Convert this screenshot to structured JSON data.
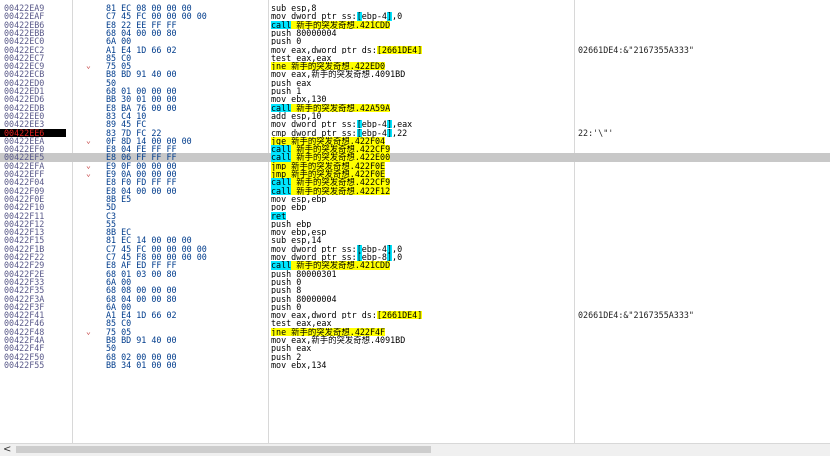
{
  "rows": [
    {
      "addr": "00422EA9",
      "arrow": "",
      "bytes": "81 EC 08 00 00 00",
      "instr": [
        {
          "t": "sub esp,8"
        }
      ],
      "cmt": ""
    },
    {
      "addr": "00422EAF",
      "arrow": "",
      "bytes": "C7 45 FC 00 00 00 00",
      "instr": [
        {
          "t": "mov dword ptr ss:"
        },
        {
          "t": "[",
          "h": "c"
        },
        {
          "t": "ebp-4"
        },
        {
          "t": "]",
          "h": "c"
        },
        {
          "t": ",0"
        }
      ],
      "cmt": ""
    },
    {
      "addr": "00422EB6",
      "arrow": "",
      "bytes": "E8 22 EE FF FF",
      "instr": [
        {
          "t": "call",
          "h": "c"
        },
        {
          "t": " 新手的突发奇想.421CDD",
          "h": "y"
        }
      ],
      "cmt": ""
    },
    {
      "addr": "00422EBB",
      "arrow": "",
      "bytes": "68 04 00 00 80",
      "instr": [
        {
          "t": "push 80000004"
        }
      ],
      "cmt": ""
    },
    {
      "addr": "00422EC0",
      "arrow": "",
      "bytes": "6A 00",
      "instr": [
        {
          "t": "push 0"
        }
      ],
      "cmt": ""
    },
    {
      "addr": "00422EC2",
      "arrow": "",
      "bytes": "A1 E4 1D 66 02",
      "instr": [
        {
          "t": "mov eax,dword ptr ds:"
        },
        {
          "t": "[2661DE4]",
          "h": "y"
        }
      ],
      "cmt": "02661DE4:&\"2167355A333\""
    },
    {
      "addr": "00422EC7",
      "arrow": "",
      "bytes": "85 C0",
      "instr": [
        {
          "t": "test eax,eax"
        }
      ],
      "cmt": ""
    },
    {
      "addr": "00422EC9",
      "arrow": "⌄",
      "bytes": "75 05",
      "instr": [
        {
          "t": "jne 新手的突发奇想.422ED0",
          "h": "y"
        }
      ],
      "cmt": ""
    },
    {
      "addr": "00422ECB",
      "arrow": "",
      "bytes": "B8 BD 91 40 00",
      "instr": [
        {
          "t": "mov eax,新手的突发奇想.4091BD"
        }
      ],
      "cmt": ""
    },
    {
      "addr": "00422ED0",
      "arrow": "",
      "bytes": "50",
      "instr": [
        {
          "t": "push eax"
        }
      ],
      "cmt": ""
    },
    {
      "addr": "00422ED1",
      "arrow": "",
      "bytes": "68 01 00 00 00",
      "instr": [
        {
          "t": "push 1"
        }
      ],
      "cmt": ""
    },
    {
      "addr": "00422ED6",
      "arrow": "",
      "bytes": "BB 30 01 00 00",
      "instr": [
        {
          "t": "mov ebx,130"
        }
      ],
      "cmt": ""
    },
    {
      "addr": "00422EDB",
      "arrow": "",
      "bytes": "E8 BA 76 00 00",
      "instr": [
        {
          "t": "call",
          "h": "c"
        },
        {
          "t": " 新手的突发奇想.42A59A",
          "h": "y"
        }
      ],
      "cmt": ""
    },
    {
      "addr": "00422EE0",
      "arrow": "",
      "bytes": "83 C4 10",
      "instr": [
        {
          "t": "add esp,10"
        }
      ],
      "cmt": ""
    },
    {
      "addr": "00422EE3",
      "arrow": "",
      "bytes": "89 45 FC",
      "instr": [
        {
          "t": "mov dword ptr ss:"
        },
        {
          "t": "[",
          "h": "c"
        },
        {
          "t": "ebp-4"
        },
        {
          "t": "]",
          "h": "c"
        },
        {
          "t": ",eax"
        }
      ],
      "cmt": ""
    },
    {
      "addr": "00422EE6",
      "arrow": "",
      "bytes": "83 7D FC 22",
      "instr": [
        {
          "t": "cmp dword ptr ss:"
        },
        {
          "t": "[",
          "h": "c"
        },
        {
          "t": "ebp-4"
        },
        {
          "t": "]",
          "h": "c"
        },
        {
          "t": ",22"
        }
      ],
      "cmt": "22:'\\\"'",
      "ip": true
    },
    {
      "addr": "00422EEA",
      "arrow": "⌄",
      "bytes": "0F 8D 14 00 00 00",
      "instr": [
        {
          "t": "jge 新手的突发奇想.422F04",
          "h": "y"
        }
      ],
      "cmt": ""
    },
    {
      "addr": "00422EF0",
      "arrow": "",
      "bytes": "E8 04 FE FF FF",
      "instr": [
        {
          "t": "call",
          "h": "c"
        },
        {
          "t": " 新手的突发奇想.422CF9",
          "h": "y"
        }
      ],
      "cmt": ""
    },
    {
      "addr": "00422EF5",
      "arrow": "",
      "bytes": "E8 06 FF FF FF",
      "instr": [
        {
          "t": "call",
          "h": "c"
        },
        {
          "t": " 新手的突发奇想.422E00",
          "h": "y"
        }
      ],
      "cmt": "",
      "sel": true
    },
    {
      "addr": "00422EFA",
      "arrow": "⌄",
      "bytes": "E9 0F 00 00 00",
      "instr": [
        {
          "t": "jmp 新手的突发奇想.422F0E",
          "h": "y"
        }
      ],
      "cmt": ""
    },
    {
      "addr": "00422EFF",
      "arrow": "⌄",
      "bytes": "E9 0A 00 00 00",
      "instr": [
        {
          "t": "jmp 新手的突发奇想.422F0E",
          "h": "y"
        }
      ],
      "cmt": ""
    },
    {
      "addr": "00422F04",
      "arrow": "",
      "bytes": "E8 F0 FD FF FF",
      "instr": [
        {
          "t": "call",
          "h": "c"
        },
        {
          "t": " 新手的突发奇想.422CF9",
          "h": "y"
        }
      ],
      "cmt": ""
    },
    {
      "addr": "00422F09",
      "arrow": "",
      "bytes": "E8 04 00 00 00",
      "instr": [
        {
          "t": "call",
          "h": "c"
        },
        {
          "t": " 新手的突发奇想.422F12",
          "h": "y"
        }
      ],
      "cmt": ""
    },
    {
      "addr": "00422F0E",
      "arrow": "",
      "bytes": "8B E5",
      "instr": [
        {
          "t": "mov esp,ebp"
        }
      ],
      "cmt": ""
    },
    {
      "addr": "00422F10",
      "arrow": "",
      "bytes": "5D",
      "instr": [
        {
          "t": "pop ebp"
        }
      ],
      "cmt": ""
    },
    {
      "addr": "00422F11",
      "arrow": "",
      "bytes": "C3",
      "instr": [
        {
          "t": "ret",
          "h": "c"
        }
      ],
      "cmt": ""
    },
    {
      "addr": "00422F12",
      "arrow": "",
      "bytes": "55",
      "instr": [
        {
          "t": "push ebp"
        }
      ],
      "cmt": ""
    },
    {
      "addr": "00422F13",
      "arrow": "",
      "bytes": "8B EC",
      "instr": [
        {
          "t": "mov ebp,esp"
        }
      ],
      "cmt": ""
    },
    {
      "addr": "00422F15",
      "arrow": "",
      "bytes": "81 EC 14 00 00 00",
      "instr": [
        {
          "t": "sub esp,14"
        }
      ],
      "cmt": ""
    },
    {
      "addr": "00422F1B",
      "arrow": "",
      "bytes": "C7 45 FC 00 00 00 00",
      "instr": [
        {
          "t": "mov dword ptr ss:"
        },
        {
          "t": "[",
          "h": "c"
        },
        {
          "t": "ebp-4"
        },
        {
          "t": "]",
          "h": "c"
        },
        {
          "t": ",0"
        }
      ],
      "cmt": ""
    },
    {
      "addr": "00422F22",
      "arrow": "",
      "bytes": "C7 45 F8 00 00 00 00",
      "instr": [
        {
          "t": "mov dword ptr ss:"
        },
        {
          "t": "[",
          "h": "c"
        },
        {
          "t": "ebp-8"
        },
        {
          "t": "]",
          "h": "c"
        },
        {
          "t": ",0"
        }
      ],
      "cmt": ""
    },
    {
      "addr": "00422F29",
      "arrow": "",
      "bytes": "E8 AF ED FF FF",
      "instr": [
        {
          "t": "call",
          "h": "c"
        },
        {
          "t": " 新手的突发奇想.421CDD",
          "h": "y"
        }
      ],
      "cmt": ""
    },
    {
      "addr": "00422F2E",
      "arrow": "",
      "bytes": "68 01 03 00 80",
      "instr": [
        {
          "t": "push 80000301"
        }
      ],
      "cmt": ""
    },
    {
      "addr": "00422F33",
      "arrow": "",
      "bytes": "6A 00",
      "instr": [
        {
          "t": "push 0"
        }
      ],
      "cmt": ""
    },
    {
      "addr": "00422F35",
      "arrow": "",
      "bytes": "68 08 00 00 00",
      "instr": [
        {
          "t": "push 8"
        }
      ],
      "cmt": ""
    },
    {
      "addr": "00422F3A",
      "arrow": "",
      "bytes": "68 04 00 00 80",
      "instr": [
        {
          "t": "push 80000004"
        }
      ],
      "cmt": ""
    },
    {
      "addr": "00422F3F",
      "arrow": "",
      "bytes": "6A 00",
      "instr": [
        {
          "t": "push 0"
        }
      ],
      "cmt": ""
    },
    {
      "addr": "00422F41",
      "arrow": "",
      "bytes": "A1 E4 1D 66 02",
      "instr": [
        {
          "t": "mov eax,dword ptr ds:"
        },
        {
          "t": "[2661DE4]",
          "h": "y"
        }
      ],
      "cmt": "02661DE4:&\"2167355A333\""
    },
    {
      "addr": "00422F46",
      "arrow": "",
      "bytes": "85 C0",
      "instr": [
        {
          "t": "test eax,eax"
        }
      ],
      "cmt": ""
    },
    {
      "addr": "00422F48",
      "arrow": "⌄",
      "bytes": "75 05",
      "instr": [
        {
          "t": "jne 新手的突发奇想.422F4F",
          "h": "y"
        }
      ],
      "cmt": ""
    },
    {
      "addr": "00422F4A",
      "arrow": "",
      "bytes": "B8 BD 91 40 00",
      "instr": [
        {
          "t": "mov eax,新手的突发奇想.4091BD"
        }
      ],
      "cmt": ""
    },
    {
      "addr": "00422F4F",
      "arrow": "",
      "bytes": "50",
      "instr": [
        {
          "t": "push eax"
        }
      ],
      "cmt": ""
    },
    {
      "addr": "00422F50",
      "arrow": "",
      "bytes": "68 02 00 00 00",
      "instr": [
        {
          "t": "push 2"
        }
      ],
      "cmt": ""
    },
    {
      "addr": "00422F55",
      "arrow": "",
      "bytes": "BB 34 01 00 00",
      "instr": [
        {
          "t": "mov ebx,134"
        }
      ],
      "cmt": ""
    }
  ],
  "scrollbar": {
    "left_arrow": "<"
  },
  "colors": {
    "call_highlight": "#00e5ff",
    "target_highlight": "#ffff00",
    "ip_bg": "#000000",
    "ip_fg": "#e02020",
    "selected_row": "#c8c8c8"
  }
}
